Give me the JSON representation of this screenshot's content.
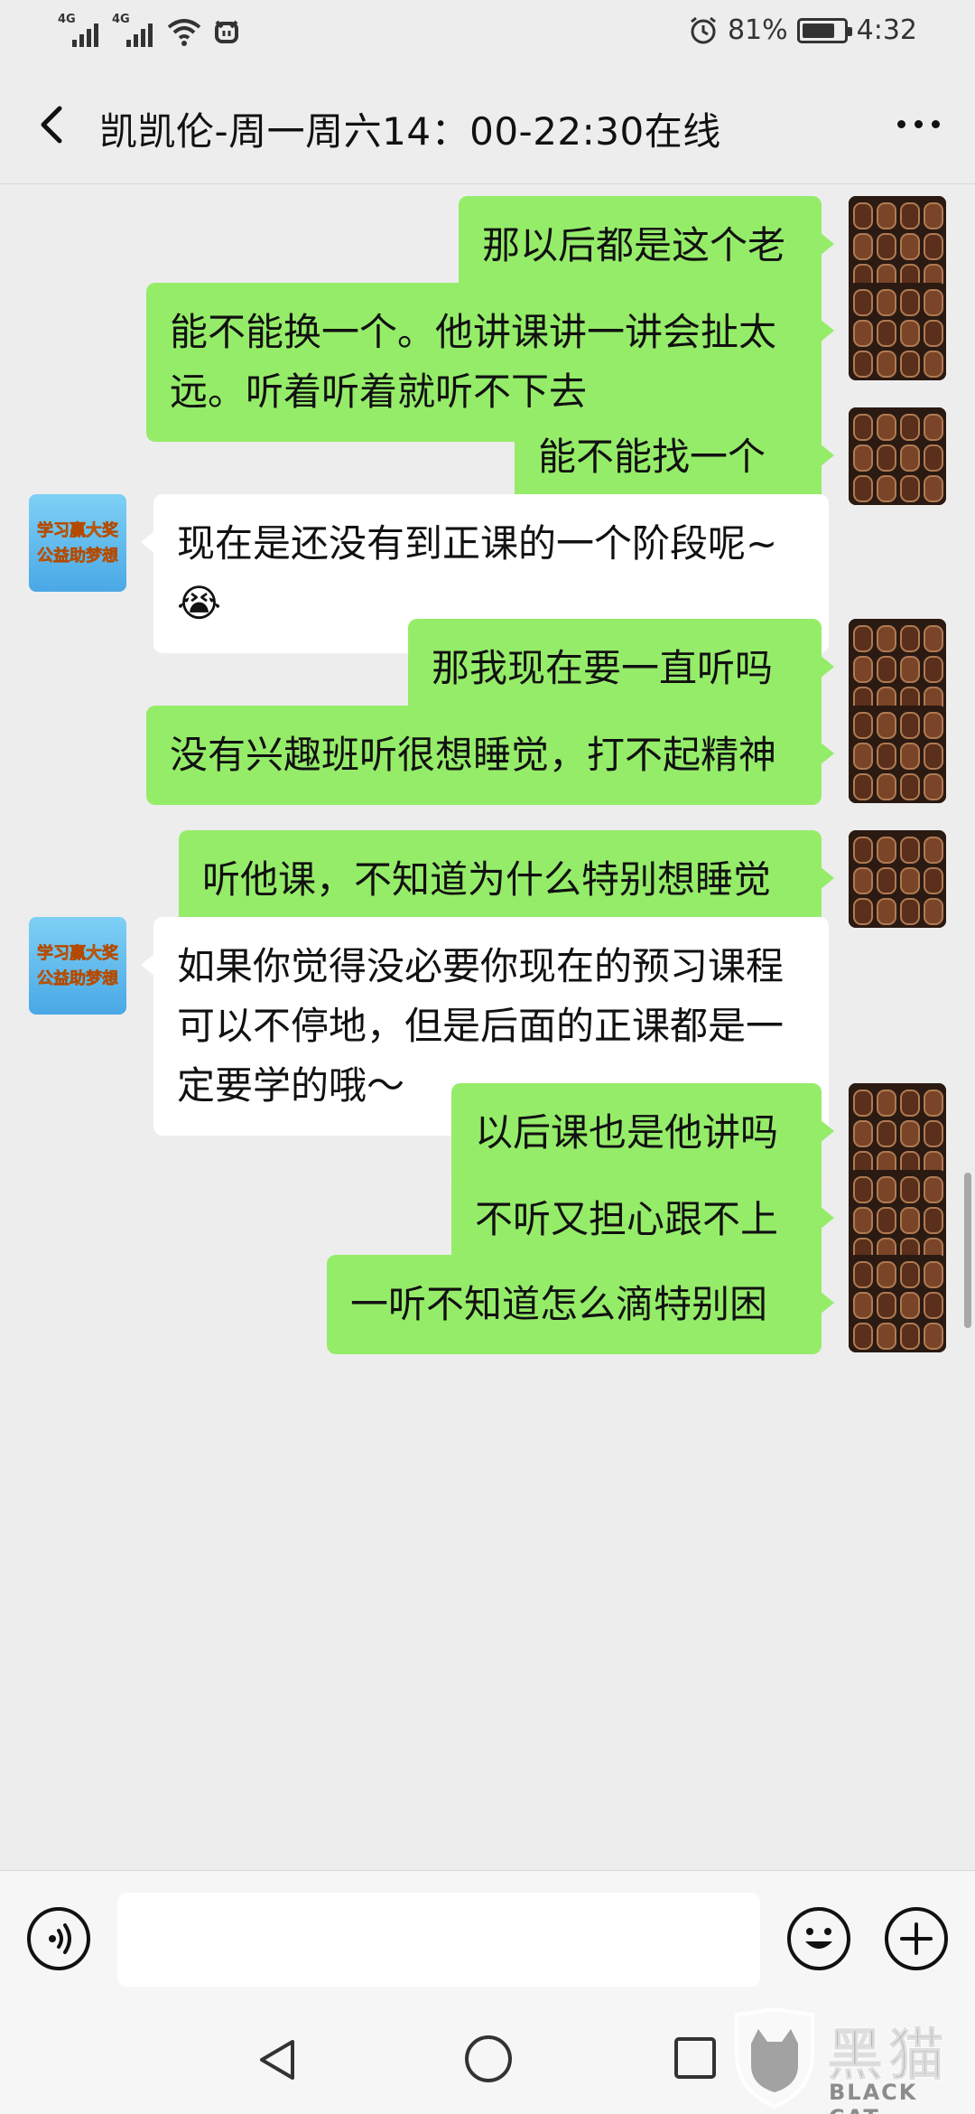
{
  "status_bar": {
    "network_1": "4G",
    "network_2": "4G",
    "battery_percent": "81%",
    "battery_level": 0.81,
    "time": "4:32"
  },
  "header": {
    "title": "凯凯伦-周一周六14：00-22:30在线"
  },
  "messages": [
    {
      "sender": "me",
      "text": "那以后都是这个老师讲的吗"
    },
    {
      "sender": "me",
      "text": "能不能换一个。他讲课讲一讲会扯太远。听着听着就听不下去"
    },
    {
      "sender": "me",
      "text": "能不能找一个专业一点"
    },
    {
      "sender": "them",
      "text": "现在是还没有到正课的一个阶段呢~😭"
    },
    {
      "sender": "me",
      "text": "那我现在要一直听吗"
    },
    {
      "sender": "me",
      "text": "没有兴趣班听很想睡觉，打不起精神"
    },
    {
      "sender": "me",
      "text": "听他课，不知道为什么特别想睡觉"
    },
    {
      "sender": "them",
      "text": "如果你觉得没必要你现在的预习课程可以不停地，但是后面的正课都是一定要学的哦～"
    },
    {
      "sender": "me",
      "text": "以后课也是他讲吗"
    },
    {
      "sender": "me",
      "text": "不听又担心跟不上"
    },
    {
      "sender": "me",
      "text": "一听不知道怎么滴特别困"
    }
  ],
  "other_avatar": {
    "line1": "学习赢大奖",
    "line2": "公益助梦想"
  },
  "input": {
    "placeholder": ""
  },
  "watermark": {
    "cn": "黑猫",
    "en": "BLACK CAT"
  },
  "colors": {
    "my_bubble": "#95ec69",
    "their_bubble": "#ffffff",
    "background": "#ededed"
  }
}
